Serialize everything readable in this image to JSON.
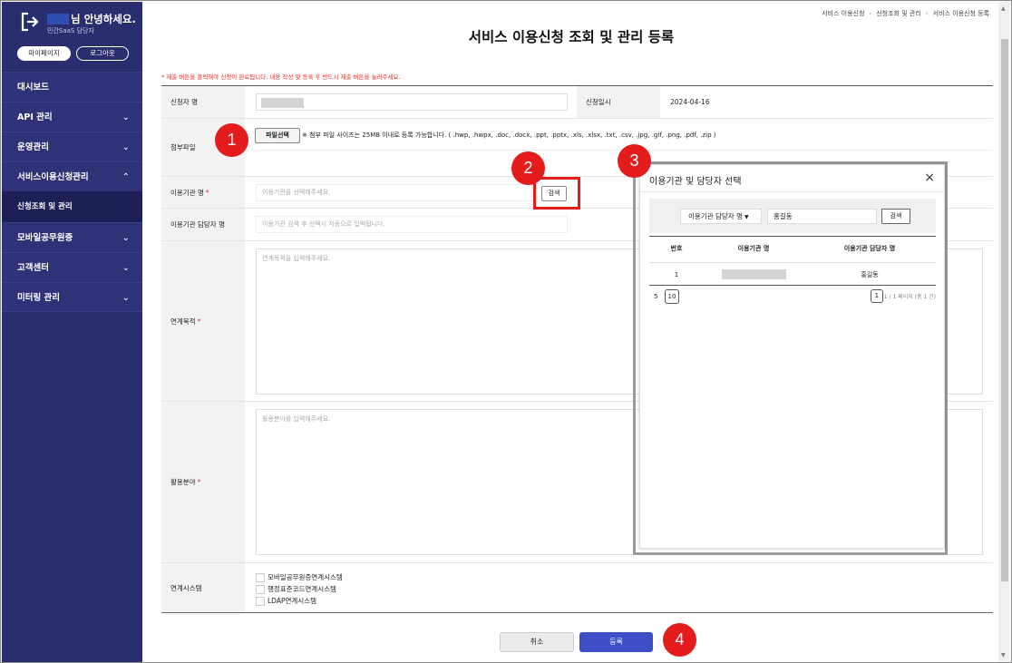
{
  "sidebar": {
    "greeting": "님 안녕하세요.",
    "role": "민간SaaS 담당자",
    "mypage_btn": "마이페이지",
    "logout_btn": "로그아웃",
    "menu": [
      {
        "label": "대시보드",
        "chevron": ""
      },
      {
        "label": "API 관리",
        "chevron": "⌄"
      },
      {
        "label": "운영관리",
        "chevron": "⌄"
      },
      {
        "label": "서비스이용신청관리",
        "chevron": "⌃"
      },
      {
        "label": "신청조회 및 관리",
        "chevron": ""
      },
      {
        "label": "모바일공무원증",
        "chevron": "⌄"
      },
      {
        "label": "고객센터",
        "chevron": "⌄"
      },
      {
        "label": "미터링 관리",
        "chevron": "⌄"
      }
    ]
  },
  "breadcrumb": [
    "서비스 이용신청",
    "신청조회 및 관리",
    "서비스 이용신청 등록"
  ],
  "page_title": "서비스 이용신청 조회 및 관리 등록",
  "notice": "* 제출 버튼을 클릭해야 신청이 완료됩니다. 내용 작성 및 등록 후 반드시 제출 버튼을 눌러주세요.",
  "form": {
    "applicant_label": "신청자 명",
    "date_label": "신청일시",
    "date_value": "2024-04-16",
    "attach_label": "첨부파일",
    "file_btn": "파일선택",
    "file_note": "※ 첨부 파일 사이즈는 25MB 이내로 등록 가능합니다. ( .hwp, .hwpx, .doc, .docx, .ppt, .pptx, .xls, .xlsx, .txt, .csv, .jpg, .gif, .png, .pdf, .zip )",
    "org_label": "이용기관 명",
    "org_placeholder": "이용기관을 선택해주세요.",
    "search_btn": "검색",
    "manager_label": "이용기관 담당자 명",
    "manager_placeholder": "이용기관 검색 후 선택시 자동으로 입력됩니다.",
    "purpose_label": "연계목적",
    "purpose_placeholder": "연계목적을 입력해주세요.",
    "field_label": "활용분야",
    "field_placeholder": "활용분야를 입력해주세요.",
    "system_label": "연계시스템",
    "systems": [
      "모바일공무원증연계시스템",
      "행정표준코드연계시스템",
      "LDAP연계시스템"
    ],
    "required_mark": "*"
  },
  "buttons": {
    "cancel": "취소",
    "submit": "등록"
  },
  "callouts": [
    "1",
    "2",
    "3",
    "4"
  ],
  "modal": {
    "title": "이용기관 및 담당자 선택",
    "close": "×",
    "select_value": "이용기관 담당자 명",
    "search_value": "홍길동",
    "search_btn": "검색",
    "headers": [
      "번호",
      "이용기관 명",
      "이용기관 담당자 명"
    ],
    "rows": [
      {
        "no": "1",
        "manager": "홍길동"
      }
    ],
    "page_size": "5",
    "page_size_box": "10",
    "current_page": "1",
    "page_info": "1 / 1 페이지 (총 1 건)"
  },
  "colors": {
    "sidebar": "#2a2d6e",
    "accent": "#3d4fc6",
    "callout": "#e41c1c"
  }
}
